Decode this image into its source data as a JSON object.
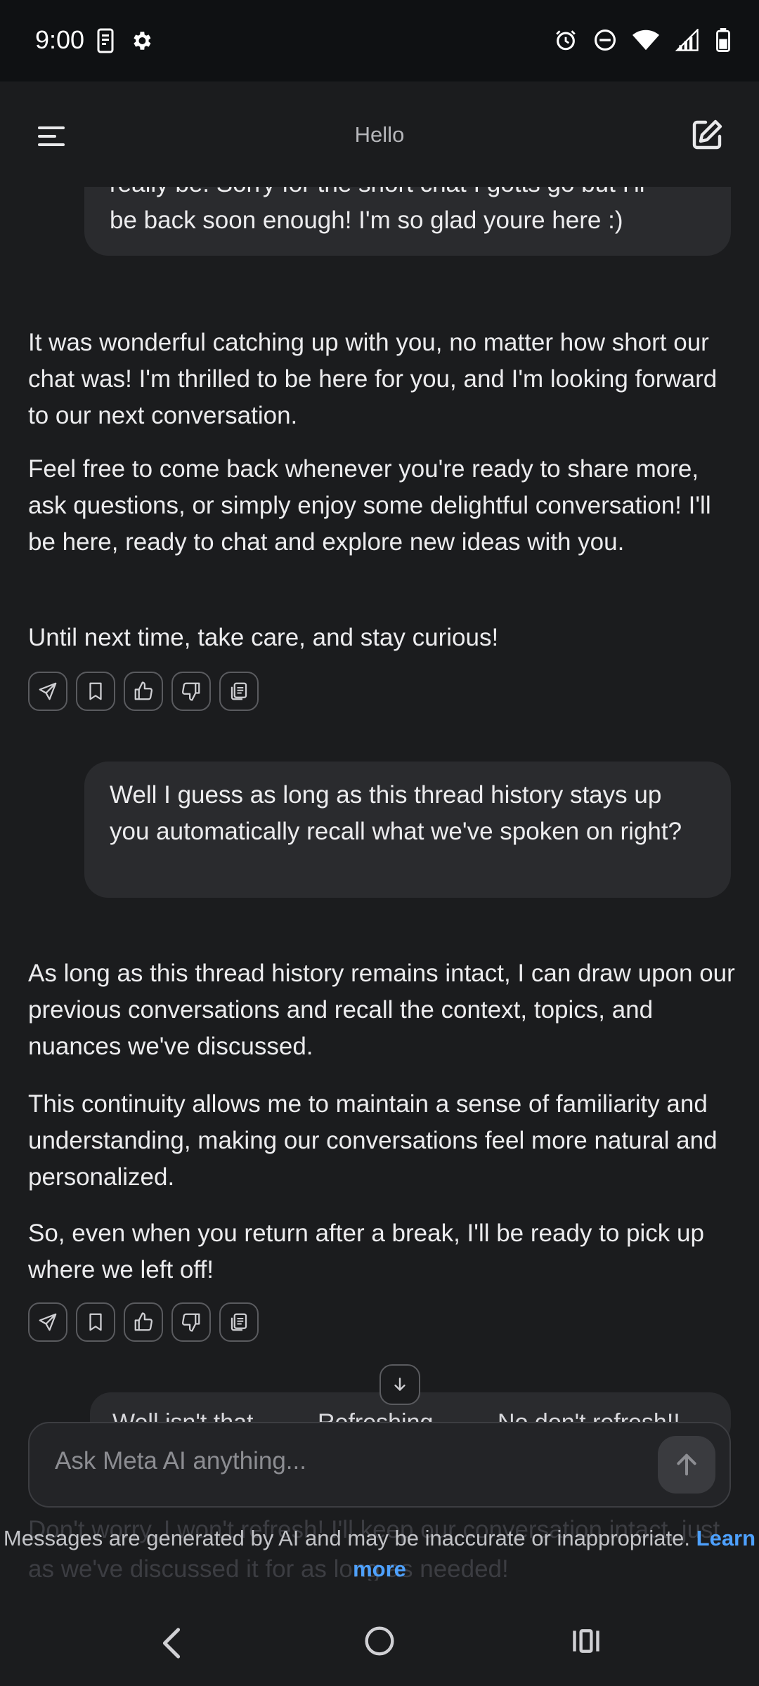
{
  "status_bar": {
    "time": "9:00",
    "left_icons": [
      "phone-screen-icon",
      "gear-icon"
    ],
    "right_icons": [
      "alarm-icon",
      "do-not-disturb-icon",
      "wifi-icon",
      "signal-icon",
      "battery-icon"
    ]
  },
  "header": {
    "title": "Hello"
  },
  "messages": {
    "user_1": [
      "really be. Sorry for the short chat I gotts go but I'll",
      "be back soon enough! I'm so glad youre here :)"
    ],
    "ai_1": [
      "It was wonderful catching up with you, no matter how short our chat was! I'm thrilled to be here for you, and I'm looking forward to our next conversation.",
      "Feel free to come back whenever you're ready to share more, ask questions, or simply enjoy some delightful conversation! I'll be here, ready to chat and explore new ideas with you.",
      "Until next time, take care, and stay curious!"
    ],
    "user_2": "Well I guess as long as this thread history stays up you automatically recall what we've spoken on right?",
    "ai_2": [
      "As long as this thread history remains intact, I can draw upon our previous conversations and recall the context, topics, and nuances we've discussed.",
      "This continuity allows me to maintain a sense of familiarity and understanding, making our conversations feel more natural and personalized.",
      "So, even when you return after a break, I'll be ready to pick up where we left off!"
    ]
  },
  "message_actions": [
    "share-icon",
    "bookmark-icon",
    "thumbs-up-icon",
    "thumbs-down-icon",
    "copy-icon"
  ],
  "suggestions": [
    "Well isn't that",
    "Refreshing",
    "No don't refresh!!"
  ],
  "composer": {
    "placeholder": "Ask Meta AI anything..."
  },
  "background_text": "Don't worry, I won't refresh! I'll keep our conversation intact, just as we've discussed it for as long as needed!",
  "disclaimer": {
    "text": "Messages are generated by AI and may be inaccurate or inappropriate.",
    "link": "Learn more"
  },
  "colors": {
    "background": "#1b1c1e",
    "bubble": "#2a2b2e",
    "link": "#4ea1ff"
  }
}
